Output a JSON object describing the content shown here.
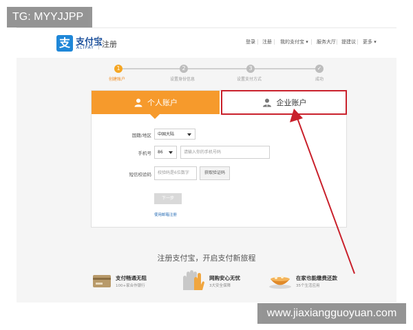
{
  "watermark": {
    "top_left": "TG: MYYJJPP",
    "bottom_right": "www.jiaxiangguoyuan.com"
  },
  "header": {
    "logo_mark": "支",
    "logo_cn": "支付宝",
    "logo_en": "ALIPAY",
    "page_title": "注册",
    "nav": [
      {
        "label": "登录"
      },
      {
        "label": "注册"
      },
      {
        "label": "我的支付宝 ▾"
      },
      {
        "label": "服务大厅"
      },
      {
        "label": "提建议"
      },
      {
        "label": "更多 ▾"
      }
    ]
  },
  "steps": [
    {
      "num": "1",
      "label": "创建账户"
    },
    {
      "num": "2",
      "label": "设置身份信息"
    },
    {
      "num": "3",
      "label": "设置支付方式"
    },
    {
      "num": "✓",
      "label": "成功"
    }
  ],
  "tabs": {
    "personal": "个人账户",
    "company": "企业账户"
  },
  "form": {
    "region_label": "国籍/地区",
    "region_value": "中国大陆",
    "phone_label": "手机号",
    "phone_code": "86",
    "phone_placeholder": "请输入你的手机号码",
    "sms_label": "短信校验码",
    "sms_placeholder": "校验码是6位数字",
    "sms_button": "获取验证码",
    "next_button": "下一步",
    "email_link": "使用邮箱注册"
  },
  "features": {
    "title": "注册支付宝，开启支付新旅程",
    "items": [
      {
        "icon": "card-icon",
        "main": "支付畅通无阻",
        "sub": "100+家合作银行"
      },
      {
        "icon": "hand-icon",
        "main": "网购安心无忧",
        "sub": "3大安全保障"
      },
      {
        "icon": "bowl-icon",
        "main": "在家也能缴费还款",
        "sub": "35个生活应用"
      }
    ]
  },
  "colors": {
    "accent_orange": "#f69a2c",
    "highlight_red": "#c9202b",
    "brand_blue": "#1f87d8"
  }
}
